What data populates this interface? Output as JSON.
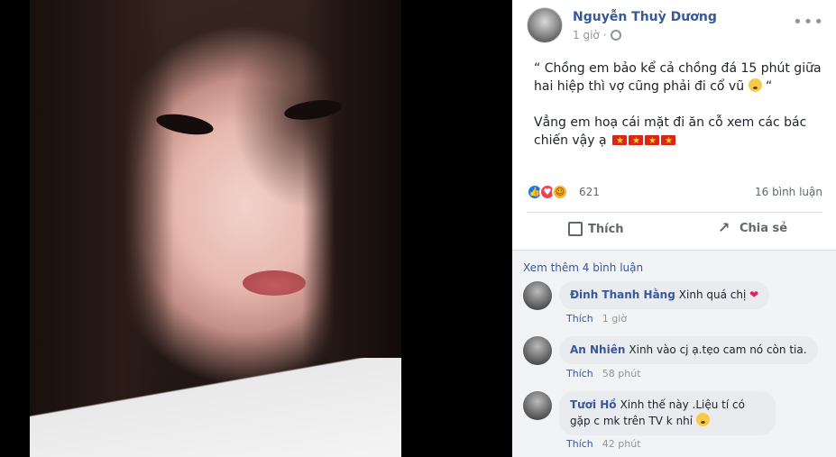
{
  "post": {
    "author": "Nguyễn Thuỳ Dương",
    "time": "1 giờ",
    "text_line1": "“ Chồng em bảo kể cả chồng đá 15 phút giữa hai hiệp thì vợ cũng phải đi cổ vũ",
    "text_line1_end": " “",
    "text_line2": "Vẳng em hoạ cái mặt đi ăn cỗ xem các bác chiến vậy ạ"
  },
  "reactions": {
    "count": "621",
    "comments": "16 bình luận"
  },
  "actions": {
    "like": "Thích",
    "share": "Chia sẻ"
  },
  "comments_section": {
    "more": "Xem thêm 4 bình luận",
    "items": [
      {
        "name": "Đinh Thanh Hằng",
        "text": "Xinh quá chị",
        "like": "Thích",
        "time": "1 giờ"
      },
      {
        "name": "An Nhiên",
        "text": "Xinh vào cj ạ.tẹo cam nó còn tia.",
        "like": "Thích",
        "time": "58 phút"
      },
      {
        "name": "Tươi Hồ",
        "text": "Xinh thế này .Liệu tí có gặp c mk trên TV k nhỉ",
        "like": "Thích",
        "time": "42 phút"
      }
    ]
  },
  "colors": {
    "link": "#385898",
    "like": "#1877f2",
    "love": "#f33e58",
    "haha": "#f7b125"
  },
  "icons": [
    "globe-icon",
    "more-options-icon",
    "like-reaction-icon",
    "love-reaction-icon",
    "haha-reaction-icon",
    "thumbs-up-icon",
    "share-arrow-icon",
    "vietnam-flag-icon",
    "worried-face-emoji",
    "heart-emoji",
    "rofl-emoji"
  ]
}
